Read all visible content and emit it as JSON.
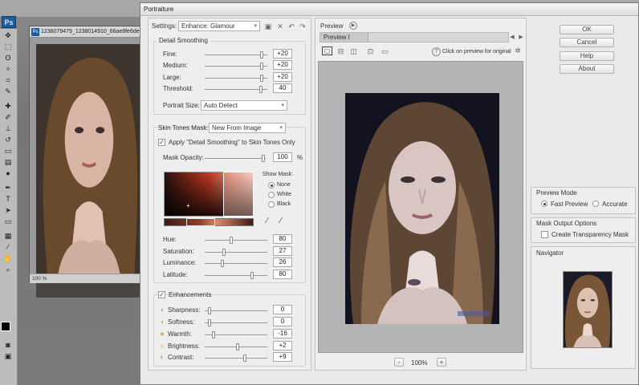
{
  "photoshop": {
    "logo": "Ps",
    "doc_tab": "1238079479_1238014910_66ae8fe6dee",
    "doc_zoom": "100 %"
  },
  "dialog": {
    "title": "Portraiture",
    "settings_label": "Settings:",
    "settings_value": "Enhance: Glamour"
  },
  "detail_smoothing": {
    "title": "Detail Smoothing",
    "rows": [
      {
        "label": "Fine:",
        "value": "+20",
        "level": 0.95
      },
      {
        "label": "Medium:",
        "value": "+20",
        "level": 0.95
      },
      {
        "label": "Large:",
        "value": "+20",
        "level": 0.95
      },
      {
        "label": "Threshold:",
        "value": "40",
        "level": 0.93
      }
    ],
    "portrait_size_label": "Portrait Size:",
    "portrait_size_value": "Auto Detect"
  },
  "skin_tones": {
    "mask_label": "Skin Tones Mask:",
    "mask_value": "New From Image",
    "apply_label": "Apply \"Detail Smoothing\" to Skin Tones Only",
    "opacity_label": "Mask Opacity:",
    "opacity_value": "100",
    "opacity_unit": "%",
    "show_mask_label": "Show Mask:",
    "show_mask_options": [
      "None",
      "White",
      "Black"
    ],
    "sliders": [
      {
        "label": "Hue:",
        "value": "80",
        "level": 0.42
      },
      {
        "label": "Saturation:",
        "value": "27",
        "level": 0.3
      },
      {
        "label": "Luminance:",
        "value": "26",
        "level": 0.28
      },
      {
        "label": "Latitude:",
        "value": "80",
        "level": 0.78
      }
    ]
  },
  "enhancements": {
    "title": "Enhancements",
    "rows": [
      {
        "label": "Sharpness:",
        "value": "0",
        "level": 0.05
      },
      {
        "label": "Softness:",
        "value": "0",
        "level": 0.05
      },
      {
        "label": "Warmth:",
        "value": "-16",
        "level": 0.13
      },
      {
        "label": "Brightness:",
        "value": "+2",
        "level": 0.53
      },
      {
        "label": "Contrast:",
        "value": "+9",
        "level": 0.66
      }
    ]
  },
  "preview": {
    "title": "Preview",
    "tab": "Preview I",
    "hint": "Click on preview for original",
    "zoom": "100%",
    "zoom_minus": "-",
    "zoom_plus": "+"
  },
  "buttons": {
    "ok": "OK",
    "cancel": "Cancel",
    "help": "Help",
    "about": "About"
  },
  "preview_mode": {
    "title": "Preview Mode",
    "fast": "Fast Preview",
    "accurate": "Accurate"
  },
  "mask_output": {
    "title": "Mask Output Options",
    "create_label": "Create Transparency Mask"
  },
  "navigator": {
    "title": "Navigator"
  }
}
